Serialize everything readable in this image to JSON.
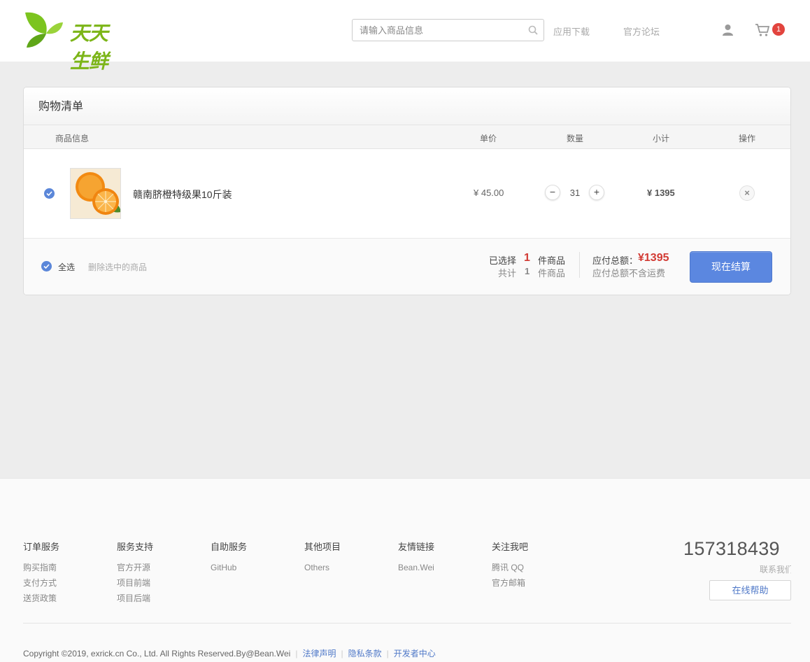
{
  "header": {
    "brand": "天天生鲜",
    "search_placeholder": "请输入商品信息",
    "nav": [
      "应用下载",
      "官方论坛"
    ],
    "cart_count": "1"
  },
  "cart": {
    "title": "购物清单",
    "columns": [
      "商品信息",
      "单价",
      "数量",
      "小计",
      "操作"
    ],
    "items": [
      {
        "name": "赣南脐橙特级果10斤装",
        "price": "¥ 45.00",
        "quantity": "31",
        "subtotal": "¥ 1395",
        "selected": true
      }
    ],
    "footer": {
      "select_all": "全选",
      "delete_selected": "删除选中的商品",
      "selected_label": "已选择",
      "selected_count": "1",
      "selected_unit": "件商品",
      "total_label": "共计",
      "total_count": "1",
      "total_unit": "件商品",
      "payable_label": "应付总额：",
      "payable_amount": "¥1395",
      "shipping_note": "应付总额不含运费",
      "checkout": "现在结算"
    }
  },
  "footer": {
    "columns": [
      {
        "title": "订单服务",
        "links": [
          "购买指南",
          "支付方式",
          "送货政策"
        ]
      },
      {
        "title": "服务支持",
        "links": [
          "官方开源",
          "项目前端",
          "项目后端"
        ]
      },
      {
        "title": "自助服务",
        "links": [
          "GitHub"
        ]
      },
      {
        "title": "其他项目",
        "links": [
          "Others"
        ]
      },
      {
        "title": "友情链接",
        "links": [
          "Bean.Wei"
        ]
      },
      {
        "title": "关注我吧",
        "links": [
          "腾讯 QQ",
          "官方邮箱"
        ]
      }
    ],
    "phone": "157318439",
    "contact": "联系我们",
    "help": "在线帮助",
    "copyright": "Copyright ©2019, exrick.cn Co., Ltd. All Rights Reserved.By@Bean.Wei",
    "legal_links": [
      "法律声明",
      "隐私条款",
      "开发者中心"
    ]
  },
  "colors": {
    "accent": "#5b87e0",
    "price_red": "#d23b34",
    "brand_green": "#7cb518"
  }
}
